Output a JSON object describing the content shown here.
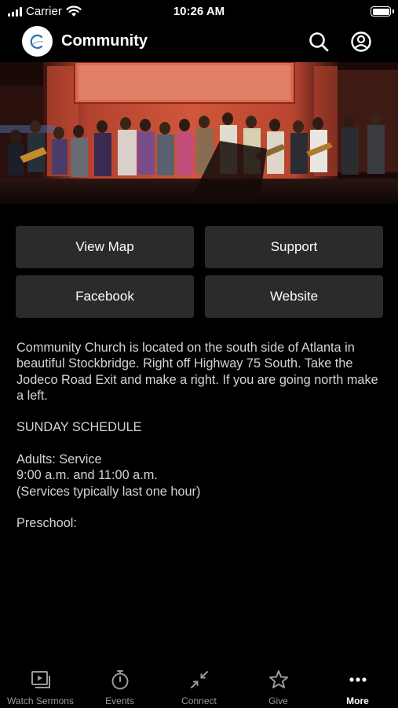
{
  "status_bar": {
    "carrier": "Carrier",
    "time": "10:26 AM"
  },
  "nav": {
    "title": "Community",
    "icons": [
      "logo",
      "search-icon",
      "account-icon"
    ]
  },
  "actions": {
    "view_map": "View Map",
    "support": "Support",
    "facebook": "Facebook",
    "website": "Website"
  },
  "description": {
    "intro": "Community Church is located on the south side of Atlanta in beautiful Stockbridge. Right off Highway 75 South. Take the Jodeco Road Exit and make a right. If you are going north make a left.",
    "schedule_heading": "SUNDAY SCHEDULE",
    "adults_label": "Adults: Service",
    "adults_times": "9:00 a.m. and 11:00 a.m.",
    "adults_note": "(Services typically last one hour)",
    "preschool_label": "Preschool:"
  },
  "tabs": [
    {
      "label": "Watch Sermons",
      "icon": "video-icon",
      "active": false
    },
    {
      "label": "Events",
      "icon": "stopwatch-icon",
      "active": false
    },
    {
      "label": "Connect",
      "icon": "arrows-in-icon",
      "active": false
    },
    {
      "label": "Give",
      "icon": "star-icon",
      "active": false
    },
    {
      "label": "More",
      "icon": "ellipsis-icon",
      "active": true
    }
  ],
  "colors": {
    "background": "#000000",
    "button": "#2b2b2b",
    "inactive_tab": "#9a9a9a"
  }
}
